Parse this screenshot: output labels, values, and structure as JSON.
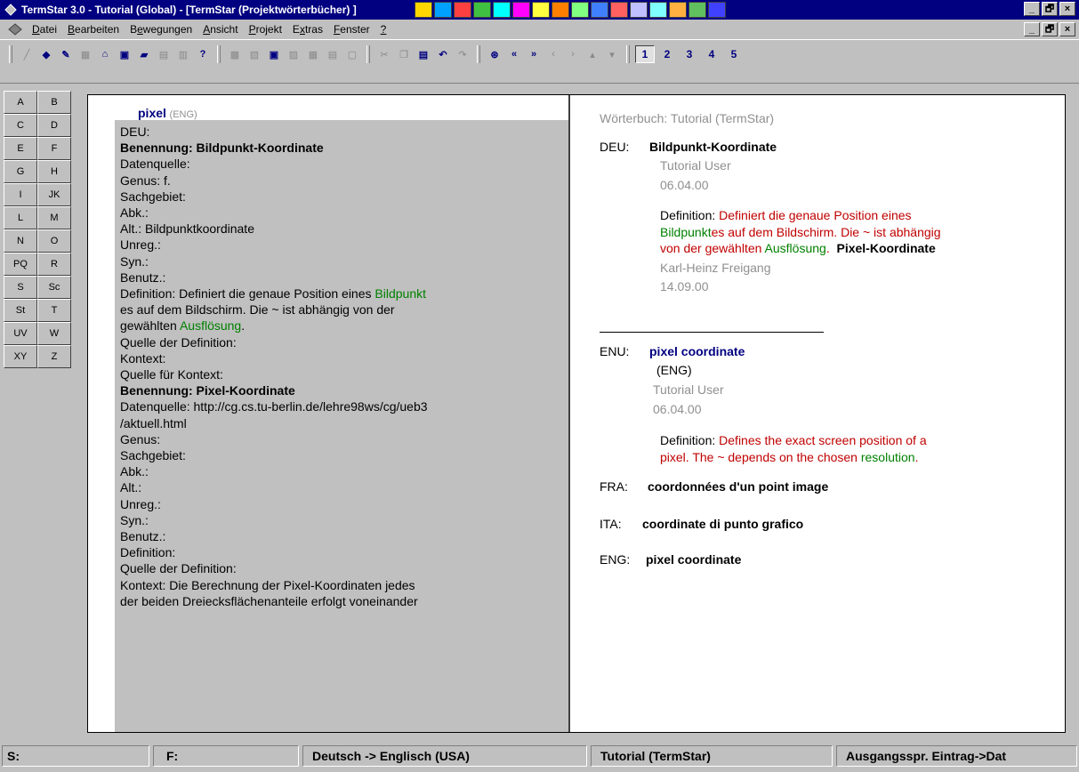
{
  "window": {
    "title": "TermStar 3.0 - Tutorial (Global) - [TermStar (Projektwörterbücher) ]",
    "icons": [
      "tray-icon",
      "tray-icon",
      "tray-icon",
      "tray-icon",
      "tray-icon",
      "tray-icon",
      "tray-icon",
      "tray-icon",
      "tray-icon",
      "tray-icon",
      "tray-icon",
      "tray-icon",
      "tray-icon",
      "tray-icon",
      "tray-icon",
      "tray-icon"
    ],
    "minimize": "_",
    "maximize": "🗗",
    "close": "×"
  },
  "menu": {
    "items": [
      {
        "u": "D",
        "rest": "atei"
      },
      {
        "u": "B",
        "rest": "earbeiten"
      },
      {
        "pre": "B",
        "u": "e",
        "rest": "wegungen"
      },
      {
        "u": "A",
        "rest": "nsicht"
      },
      {
        "u": "P",
        "rest": "rojekt"
      },
      {
        "pre": "E",
        "u": "x",
        "rest": "tras"
      },
      {
        "u": "F",
        "rest": "enster"
      },
      {
        "u": "?",
        "rest": ""
      }
    ]
  },
  "toolbar": {
    "pages": [
      "1",
      "2",
      "3",
      "4",
      "5"
    ],
    "help_label": "?"
  },
  "alphabet": [
    "A",
    "B",
    "C",
    "D",
    "E",
    "F",
    "G",
    "H",
    "I",
    "JK",
    "L",
    "M",
    "N",
    "O",
    "PQ",
    "R",
    "S",
    "Sc",
    "St",
    "T",
    "UV",
    "W",
    "XY",
    "Z"
  ],
  "left": {
    "term": "pixel",
    "term_lang": "(ENG)",
    "lines": [
      {
        "t": "DEU:"
      },
      {
        "t": "Benennung: Bildpunkt-Koordinate",
        "b": true
      },
      {
        "t": "Datenquelle:"
      },
      {
        "t": "Genus: f."
      },
      {
        "t": "Sachgebiet:"
      },
      {
        "t": "Abk.:"
      },
      {
        "t": "Alt.: Bildpunktkoordinate"
      },
      {
        "t": "Unreg.:"
      },
      {
        "t": "Syn.:"
      },
      {
        "t": "Benutz.:"
      },
      {
        "t": "Definition: Definiert die genaue Position eines ",
        "g": "Bildpunkt"
      },
      {
        "t": "es auf dem Bildschirm. Die ~ ist abhängig von der"
      },
      {
        "t": "gewählten ",
        "g": "Ausflösung",
        "after": "."
      },
      {
        "t": "Quelle der Definition:"
      },
      {
        "t": "Kontext:"
      },
      {
        "t": "Quelle für Kontext:"
      },
      {
        "t": "Benennung: Pixel-Koordinate",
        "b": true
      },
      {
        "t": "Datenquelle: http://cg.cs.tu-berlin.de/lehre98ws/cg/ueb3"
      },
      {
        "t": "/aktuell.html"
      },
      {
        "t": "Genus:"
      },
      {
        "t": "Sachgebiet:"
      },
      {
        "t": "Abk.:"
      },
      {
        "t": "Alt.:"
      },
      {
        "t": "Unreg.:"
      },
      {
        "t": "Syn.:"
      },
      {
        "t": "Benutz.:"
      },
      {
        "t": "Definition:"
      },
      {
        "t": "Quelle der Definition:"
      },
      {
        "t": "Kontext: Die Berechnung der Pixel-Koordinaten jedes"
      },
      {
        "t": "der beiden Dreiecksflächenanteile erfolgt voneinander"
      }
    ]
  },
  "right": {
    "dictionary": "Wörterbuch: Tutorial (TermStar)",
    "deu": {
      "code": "DEU:",
      "term": "Bildpunkt-Koordinate",
      "user": "Tutorial User",
      "date": "06.04.00",
      "def_label": "Definition: ",
      "def_1": "Definiert die genaue Position eines",
      "def_2g": "Bildpunkt",
      "def_2r": "es auf dem Bildschirm. Die ~ ist abhängig",
      "def_3r": "von der gewählten ",
      "def_3g": "Ausflösung",
      "def_3dot": ".",
      "def_3b": "Pixel-Koordinate",
      "author": "Karl-Heinz Freigang",
      "author_date": "14.09.00"
    },
    "enu": {
      "code": "ENU:",
      "term": "pixel coordinate",
      "lang": "(ENG)",
      "user": "Tutorial User",
      "date": "06.04.00",
      "def_label": "Definition: ",
      "def_1": "Defines the exact screen position of a",
      "def_2": "pixel. The ~ depends on the chosen ",
      "def_2g": "resolution",
      "def_2dot": "."
    },
    "fra": {
      "code": "FRA:",
      "term": "coordonnées d'un point image"
    },
    "ita": {
      "code": "ITA:",
      "term": "coordinate di punto grafico"
    },
    "eng": {
      "code": "ENG:",
      "term": "pixel coordinate"
    }
  },
  "status": {
    "s": "S:",
    "f": "F:",
    "direction": "Deutsch -> Englisch (USA)",
    "dictionary": "Tutorial (TermStar)",
    "sort": "Ausgangsspr. Eintrag->Dat"
  }
}
